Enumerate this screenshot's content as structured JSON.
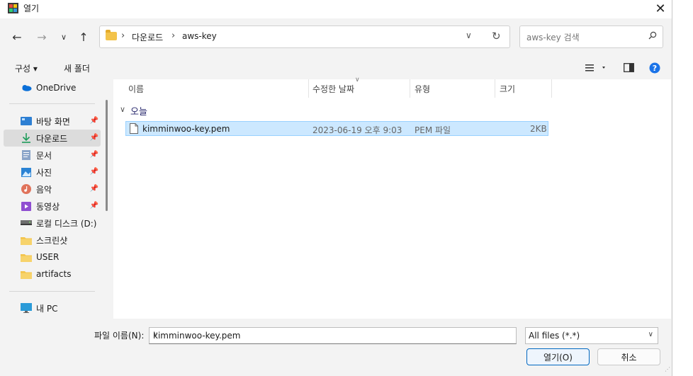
{
  "window": {
    "title": "열기",
    "close_glyph": "✕"
  },
  "address": {
    "crumbs": [
      "다운로드",
      "aws-key"
    ],
    "separator": "›"
  },
  "search": {
    "placeholder": "aws-key 검색"
  },
  "toolbar": {
    "organize_label": "구성 ▾",
    "new_folder_label": "새 폴더"
  },
  "sidebar": {
    "items": [
      {
        "label": "OneDrive",
        "icon": "cloud-icon"
      },
      {
        "label": "바탕 화면",
        "icon": "desktop-icon",
        "pinned": true
      },
      {
        "label": "다운로드",
        "icon": "download-icon",
        "pinned": true,
        "selected": true
      },
      {
        "label": "문서",
        "icon": "document-icon",
        "pinned": true
      },
      {
        "label": "사진",
        "icon": "picture-icon",
        "pinned": true
      },
      {
        "label": "음악",
        "icon": "music-icon",
        "pinned": true
      },
      {
        "label": "동영상",
        "icon": "video-icon",
        "pinned": true
      },
      {
        "label": "로컬 디스크 (D:)",
        "icon": "drive-icon"
      },
      {
        "label": "스크린샷",
        "icon": "folder-icon"
      },
      {
        "label": "USER",
        "icon": "folder-icon"
      },
      {
        "label": "artifacts",
        "icon": "folder-icon"
      },
      {
        "label": "내 PC",
        "icon": "pc-icon"
      }
    ]
  },
  "columns": [
    "이름",
    "수정한 날짜",
    "유형",
    "크기"
  ],
  "groups": [
    {
      "label": "오늘",
      "files": [
        {
          "name": "kimminwoo-key.pem",
          "modified": "2023-06-19 오후 9:03",
          "type": "PEM 파일",
          "size": "2KB"
        }
      ]
    }
  ],
  "footer": {
    "filename_label": "파일 이름(N):",
    "filename_value": "kimminwoo-key.pem",
    "filetype_value": "All files (*.*)",
    "open_label": "열기(O)",
    "cancel_label": "취소"
  },
  "colors": {
    "accent": "#0067c0",
    "selection": "#cce8ff",
    "folder": "#f3c34a",
    "help": "#1a73e8"
  }
}
